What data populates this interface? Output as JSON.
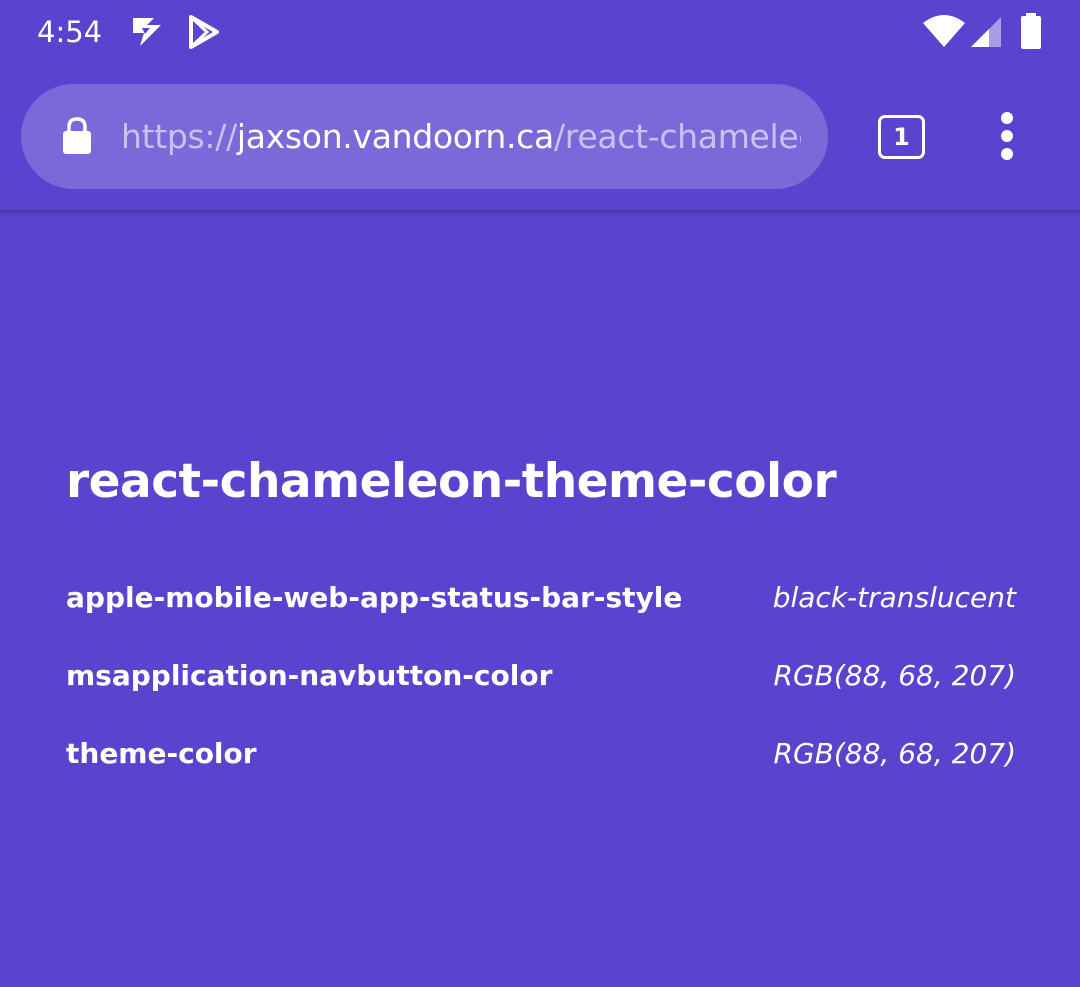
{
  "status_bar": {
    "time": "4:54",
    "icons": [
      "play-games-icon",
      "play-store-icon",
      "wifi-icon",
      "cell-signal-icon",
      "battery-icon"
    ]
  },
  "browser": {
    "url_scheme": "https://",
    "url_host": "jaxson.vandoorn.ca",
    "url_path": "/react-chameleon-theme-color",
    "tab_count": "1",
    "toolbar_color": "#5844CF",
    "omnibox_color": "#7A69D9"
  },
  "page": {
    "title": "react-chameleon-theme-color",
    "background_color": "#5844CF",
    "meta_tags": [
      {
        "name": "apple-mobile-web-app-status-bar-style",
        "value": "black-translucent"
      },
      {
        "name": "msapplication-navbutton-color",
        "value": "RGB(88, 68, 207)"
      },
      {
        "name": "theme-color",
        "value": "RGB(88, 68, 207)"
      }
    ]
  }
}
